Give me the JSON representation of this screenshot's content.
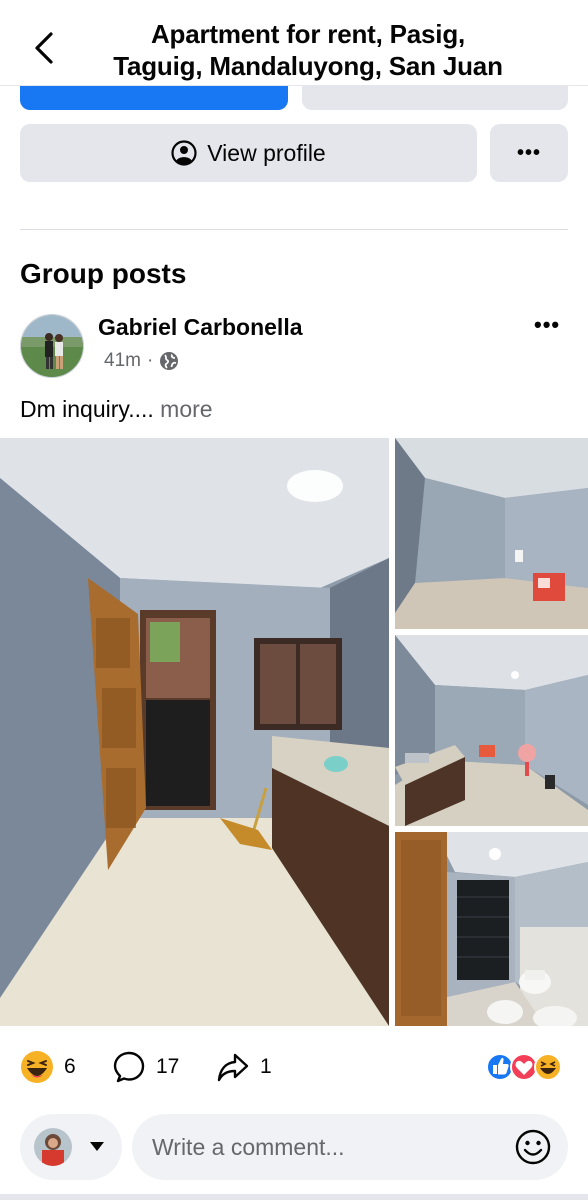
{
  "header": {
    "title_line1": "Apartment for rent,  Pasig,",
    "title_line2": "Taguig, Mandaluyong, San Juan"
  },
  "profile_actions": {
    "view_profile_label": "View profile",
    "more_label": "•••"
  },
  "section": {
    "title": "Group posts"
  },
  "post": {
    "author": "Gabriel Carbonella",
    "time": "41m",
    "privacy_icon": "globe-icon",
    "text": "Dm inquiry....",
    "more_link": "more",
    "options_label": "•••",
    "photos": [
      "kitchen-photo",
      "room-photo",
      "living-area-photo",
      "bathroom-photo"
    ]
  },
  "engagement": {
    "reaction_count": "6",
    "comment_count": "17",
    "share_count": "1",
    "reaction_icons": [
      "like-icon",
      "love-icon",
      "haha-icon"
    ]
  },
  "comment": {
    "placeholder": "Write a comment..."
  },
  "colors": {
    "accent": "#1877f2",
    "button_gray": "#e4e6eb",
    "secondary_text": "#65676b",
    "love": "#f33e58",
    "haha": "#f7b125"
  }
}
